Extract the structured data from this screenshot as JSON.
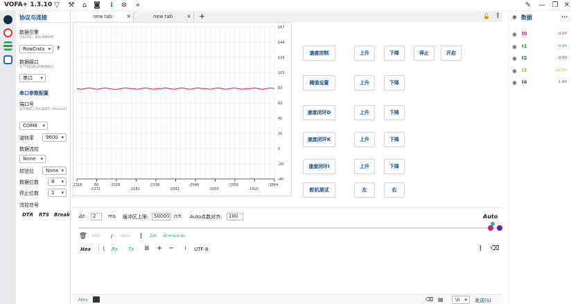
{
  "app": {
    "title": "VOFA+ 1.3.10"
  },
  "left_panel": {
    "heading": "协议与连接",
    "engine_label": "数据引擎",
    "engine_hint": "点击问号，跳往详细文档",
    "engine_value": "RawData",
    "engine_help": "?",
    "interface_label": "数据接口",
    "interface_hint": "与下位机通信的物理接口",
    "interface_value": "串口",
    "serial_heading": "串口参数配置",
    "port_label": "端口号",
    "port_hint": "蓝牙链接上的标准串行, Microsoft",
    "port_value": "COM8",
    "baud_label": "波特率",
    "baud_value": "9600",
    "flow_label": "数据流控",
    "flow_value": "None",
    "parity_label": "校验位",
    "parity_value": "None",
    "databits_label": "数据位数",
    "databits_value": "8",
    "stopbits_label": "停止位数",
    "stopbits_value": "1",
    "flowsig_label": "流控信号",
    "dtr": "DTR",
    "rts": "RTS",
    "brk": "Break"
  },
  "tabs": [
    {
      "label": "new tab",
      "close": "×"
    },
    {
      "label": "new tab",
      "close": "×"
    }
  ],
  "tab_add": "+",
  "chart_data": {
    "type": "line",
    "ylim": [
      -40,
      167
    ],
    "y_ticks": [
      "167",
      "144",
      "124",
      "103",
      "83",
      "62",
      "41",
      "21",
      "0",
      "-20",
      "-40"
    ],
    "x_ticks": [
      "-2318",
      "-2272",
      "-2228",
      "-2182",
      "-2136",
      "-2092",
      "-2046",
      "-2000",
      "-1956",
      "-1910",
      "-1864"
    ],
    "extra_tick": "80",
    "series": [
      {
        "values": [
          83,
          82,
          83,
          84,
          83,
          82,
          83,
          84,
          83,
          82,
          82,
          83,
          84,
          83,
          83,
          82,
          83,
          84,
          83,
          82,
          83,
          83,
          84,
          83,
          82,
          83,
          84,
          83,
          82,
          83,
          84,
          83,
          83,
          82,
          83,
          84,
          83,
          82,
          83,
          84,
          83,
          82,
          83,
          83,
          84,
          83,
          82,
          83,
          84,
          83
        ],
        "color": "#e0136a"
      }
    ]
  },
  "buttons": {
    "speed_ctrl": "速度控制",
    "up1": "上升",
    "down1": "下降",
    "stop": "停止",
    "start": "开启",
    "thresh": "阈值设置",
    "up2": "上升",
    "down2": "下降",
    "speed_d": "速度闭环D",
    "up3": "上升",
    "down3": "下降",
    "speed_k": "速度闭环K",
    "up4": "上升",
    "down4": "下降",
    "speed_i": "速度闭环I",
    "up5": "上升",
    "down5": "下降",
    "servo": "舵机测试",
    "left": "左",
    "right": "右"
  },
  "right_panel": {
    "title": "数据",
    "more": "···",
    "channels": [
      {
        "name": "I0",
        "value": "0.00",
        "color": "#d6137a"
      },
      {
        "name": "I1",
        "value": "0.00",
        "color": "#3a9a2e"
      },
      {
        "name": "I2",
        "value": "0.00",
        "color": "#1e4fd0"
      },
      {
        "name": "I3",
        "value": "22.00",
        "color": "#e2a212"
      },
      {
        "name": "I4",
        "value": "1.90",
        "color": "#7a2db4"
      }
    ]
  },
  "controls": {
    "dt_label": "Δt:",
    "dt_value": "2",
    "dt_unit": "ms",
    "buf_label": "缓冲区上限:",
    "buf_value": "50000",
    "buf_unit": "/ch",
    "align_label": "Auto点数对齐:",
    "align_value": "100",
    "auto": "Auto",
    "stat_a": "0000",
    "stat_sep": "/",
    "stat_b": "0000",
    "stat_c": "228",
    "stat_d": "45.4ms/X div",
    "hex": "Hex",
    "rx": "Rx",
    "tx": "Tx",
    "encoding": "UTF-8"
  },
  "send": {
    "hex": "Hex",
    "newline": "\\n",
    "send": "发送(S)"
  }
}
